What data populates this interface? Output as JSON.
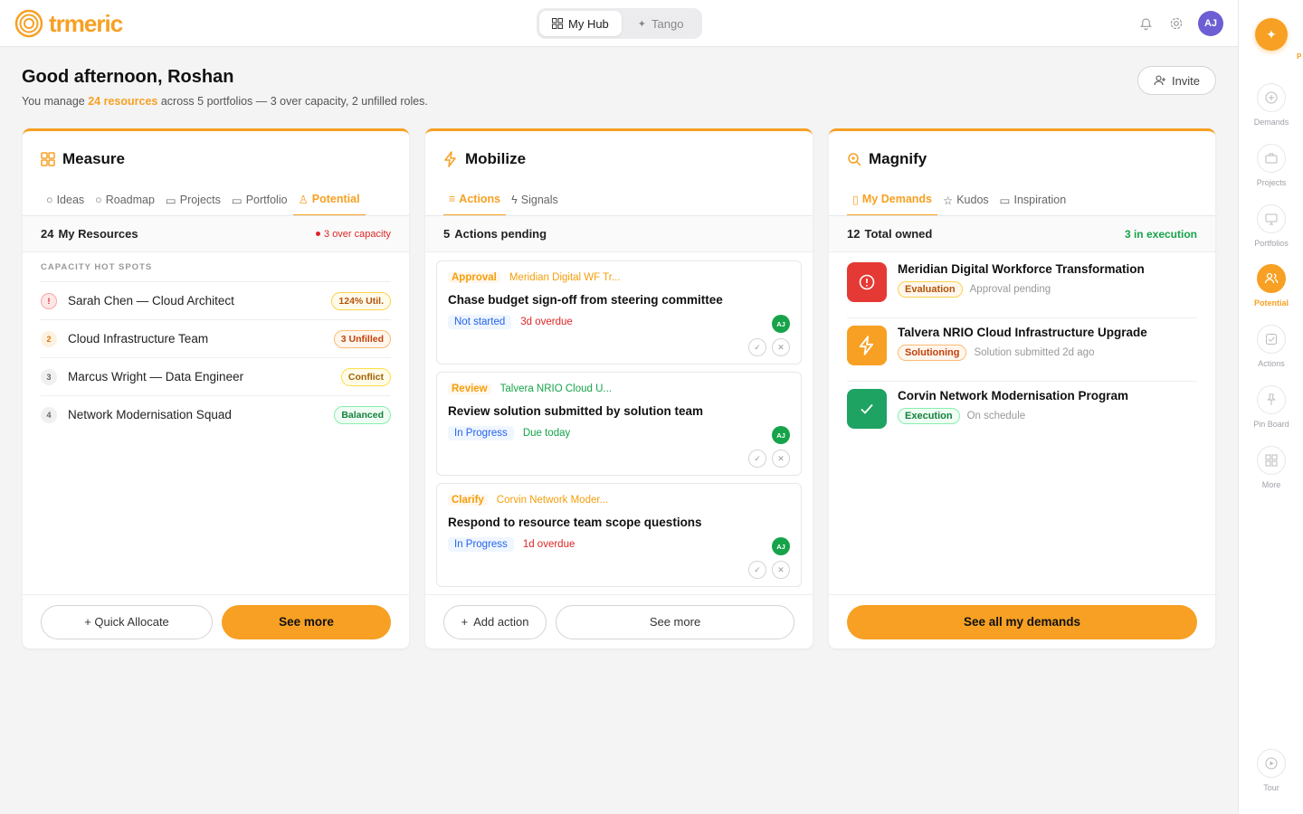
{
  "brand": {
    "name": "trmeric",
    "accent": "#f7a023"
  },
  "mode_switch": {
    "items": [
      {
        "label": "My Hub",
        "icon": "grid-icon"
      },
      {
        "label": "Tango",
        "icon": "sparkle-icon"
      }
    ],
    "active": 0
  },
  "user": {
    "initials": "AJ"
  },
  "greeting": {
    "title": "Good afternoon, Roshan",
    "prefix": "You manage",
    "highlight": "24 resources",
    "suffix": "across 5 portfolios — 3 over capacity, 2 unfilled roles."
  },
  "invite_label": "Invite",
  "measure": {
    "title": "Measure",
    "tabs": [
      "Ideas",
      "Roadmap",
      "Projects",
      "Portfolio",
      "Potential"
    ],
    "active_tab": 4,
    "count": "24",
    "summary": "My Resources",
    "warning": "3 over capacity",
    "section": "CAPACITY HOT SPOTS",
    "rows": [
      {
        "rank": "!",
        "name": "Sarah Chen — Cloud Architect",
        "badge": "124% Util."
      },
      {
        "rank": "2",
        "name": "Cloud Infrastructure Team",
        "badge": "3 Unfilled"
      },
      {
        "rank": "3",
        "name": "Marcus Wright — Data Engineer",
        "badge": "Conflict"
      },
      {
        "rank": "4",
        "name": "Network Modernisation Squad",
        "badge": "Balanced"
      }
    ],
    "quick_allocate": "+ Quick Allocate",
    "see_more": "See more"
  },
  "mobilize": {
    "title": "Mobilize",
    "tabs": [
      "Actions",
      "Signals"
    ],
    "active_tab": 0,
    "count": "5",
    "summary": "Actions pending",
    "actions": [
      {
        "type": "Approval",
        "link": "Meridian Digital WF Tr...",
        "title": "Chase budget sign-off from steering committee",
        "status": "Not started",
        "due": "3d overdue",
        "assignee": "AJ"
      },
      {
        "type": "Review",
        "link": "Talvera NRIO Cloud U...",
        "title": "Review solution submitted by solution team",
        "status": "In Progress",
        "due": "Due today",
        "assignee": "AJ"
      },
      {
        "type": "Clarify",
        "link": "Corvin Network Moder...",
        "title": "Respond to resource team scope questions",
        "status": "In Progress",
        "due": "1d overdue",
        "assignee": "AJ"
      }
    ],
    "add_action": "Add action",
    "see_more": "See more"
  },
  "magnify": {
    "title": "Magnify",
    "tabs": [
      "My Demands",
      "Kudos",
      "Inspiration"
    ],
    "active_tab": 0,
    "count": "12",
    "summary": "Total owned",
    "in_execution": "3 in execution",
    "demands": [
      {
        "title": "Meridian Digital Workforce Transformation",
        "stage": "Evaluation",
        "note": "Approval pending",
        "icon": "alert-icon",
        "color": "#e53935"
      },
      {
        "title": "Talvera NRIO Cloud Infrastructure Upgrade",
        "stage": "Solutioning",
        "note": "Solution submitted 2d ago",
        "icon": "bolt-icon",
        "color": "#f7a023"
      },
      {
        "title": "Corvin Network Modernisation Program",
        "stage": "Execution",
        "note": "On schedule",
        "icon": "check-icon",
        "color": "#1ea362"
      }
    ],
    "see_all": "See all my demands"
  },
  "rail": {
    "top_badge": "P",
    "items": [
      {
        "label": "Demands",
        "icon": "plus-circle-icon"
      },
      {
        "label": "Projects",
        "icon": "briefcase-icon"
      },
      {
        "label": "Portfolios",
        "icon": "monitor-icon"
      },
      {
        "label": "Potential",
        "icon": "users-icon"
      },
      {
        "label": "Actions",
        "icon": "checkbox-icon"
      },
      {
        "label": "Pin Board",
        "icon": "pin-icon"
      },
      {
        "label": "More",
        "icon": "grid-icon"
      }
    ],
    "active": 3,
    "tour": "Tour"
  }
}
